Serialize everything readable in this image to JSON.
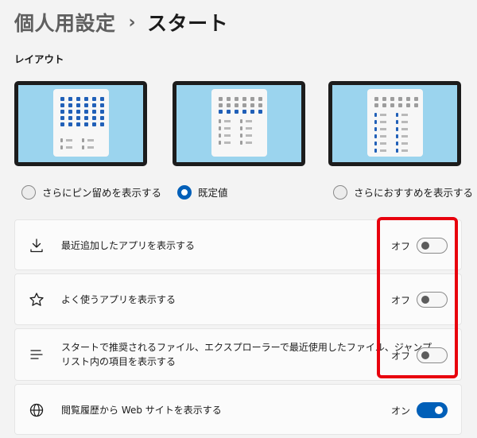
{
  "breadcrumb": {
    "parent": "個人用設定",
    "separator": "›",
    "current": "スタート"
  },
  "layout_section": {
    "label": "レイアウト",
    "options": [
      {
        "label": "さらにピン留めを表示する",
        "selected": false
      },
      {
        "label": "既定値",
        "selected": true
      },
      {
        "label": "さらにおすすめを表示する",
        "selected": false
      }
    ]
  },
  "settings": [
    {
      "icon": "download-icon",
      "label": "最近追加したアプリを表示する",
      "state_label": "オフ",
      "on": false
    },
    {
      "icon": "star-icon",
      "label": "よく使うアプリを表示する",
      "state_label": "オフ",
      "on": false
    },
    {
      "icon": "list-lines-icon",
      "label_line1": "スタートで推奨されるファイル、エクスプローラーで最近使用したファイル、ジャンプ",
      "label_line2": "リスト内の項目を表示する",
      "state_label": "オフ",
      "on": false
    },
    {
      "icon": "globe-icon",
      "label": "閲覧履歴から Web サイトを表示する",
      "state_label": "オン",
      "on": true
    }
  ],
  "colors": {
    "accent": "#005fb8",
    "highlight": "#e8000d",
    "thumbnail_bg": "#9bd4ee"
  }
}
